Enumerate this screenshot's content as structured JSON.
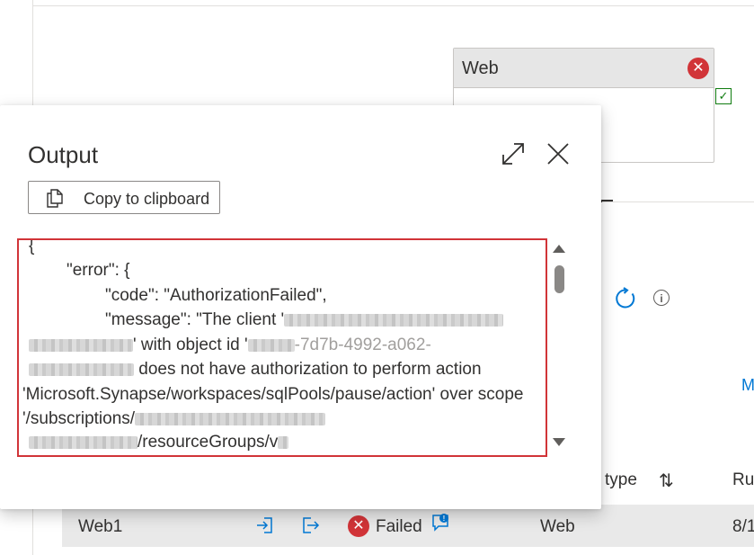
{
  "canvas": {
    "web_node": {
      "title": "Web",
      "error_icon": "error-circle-icon",
      "ok_icon": "checkbox-checked-icon"
    },
    "toolbar_icons": [
      "refresh-icon",
      "info-icon"
    ],
    "cut_link": "M"
  },
  "table": {
    "columns": {
      "type": "type",
      "ru": "Ru"
    },
    "row": {
      "name": "Web1",
      "status": "Failed",
      "type": "Web",
      "date": "8/1"
    }
  },
  "output_panel": {
    "title": "Output",
    "copy_button": "Copy to clipboard",
    "code": {
      "line1": "{",
      "line2": "\"error\": {",
      "line3": "\"code\": \"AuthorizationFailed\",",
      "line4": "\"message\": \"The client '",
      "line5b": "' with object id '",
      "line5c": "-7d7b-4992-a062-",
      "line6b": " does not have authorization to perform action",
      "line7": "'Microsoft.Synapse/workspaces/sqlPools/pause/action' over scope",
      "line8": "'/subscriptions/",
      "line9b": "/resourceGroups/",
      "line9c": "v"
    }
  },
  "colors": {
    "error": "#d13438",
    "accent": "#0078d4",
    "success": "#107c10",
    "border": "#8a8886"
  }
}
